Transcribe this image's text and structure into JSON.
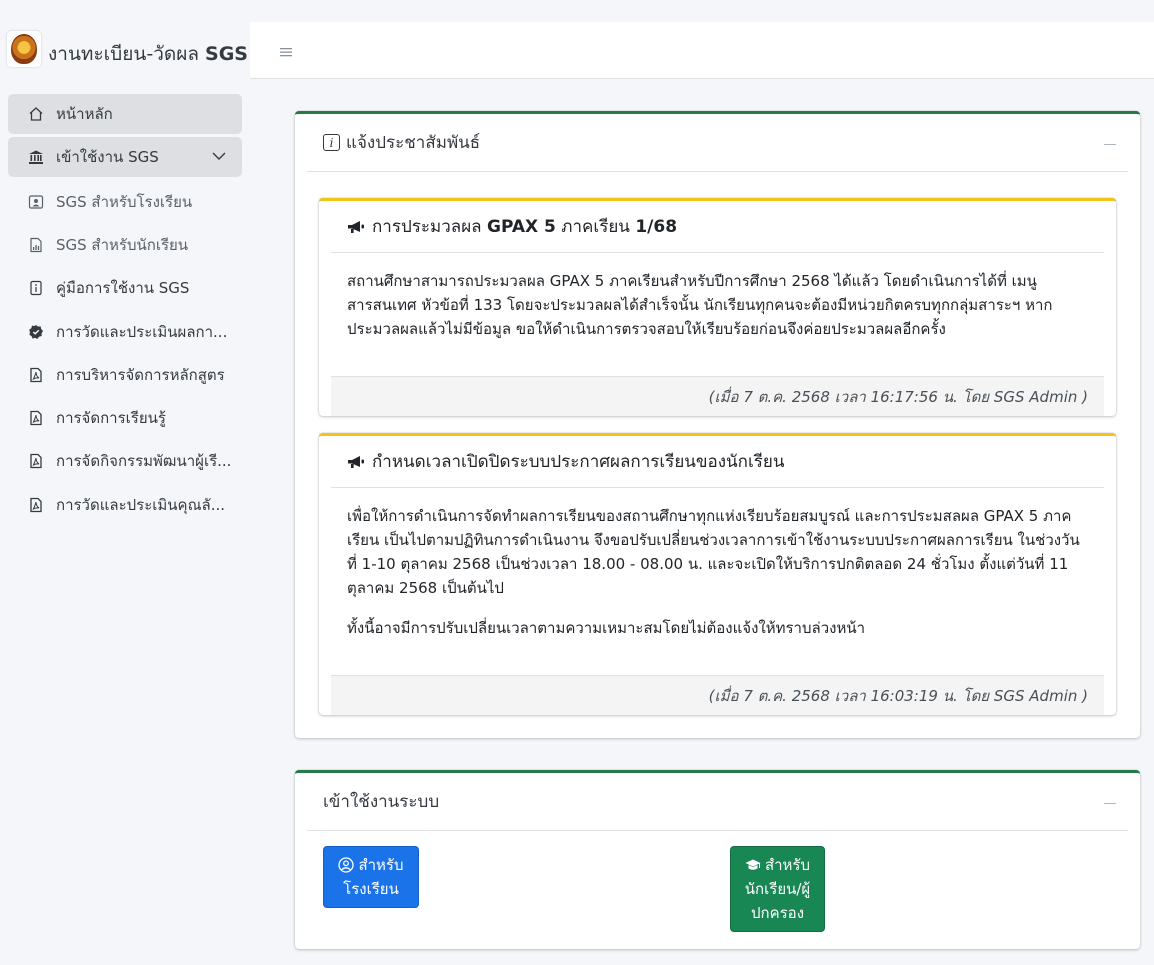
{
  "brand": {
    "prefix": "งานทะเบียน-วัดผล",
    "name": "SGS"
  },
  "sidebar": {
    "items": [
      {
        "label": "หน้าหลัก",
        "icon": "home-icon"
      },
      {
        "label": "เข้าใช้งาน SGS",
        "icon": "bank-icon"
      }
    ],
    "sub_items": [
      {
        "label": "SGS สำหรับโรงเรียน",
        "icon": "person-badge-icon"
      },
      {
        "label": "SGS สำหรับนักเรียน",
        "icon": "file-chart-icon"
      },
      {
        "label": "คู่มือการใช้งาน SGS",
        "icon": "file-info-icon"
      },
      {
        "label": "การวัดและประเมินผลกา...",
        "icon": "patch-check-icon"
      },
      {
        "label": "การบริหารจัดการหลักสูตร",
        "icon": "file-pdf-icon"
      },
      {
        "label": "การจัดการเรียนรู้",
        "icon": "file-pdf-icon"
      },
      {
        "label": "การจัดกิจกรรมพัฒนาผู้เรี...",
        "icon": "file-pdf-icon"
      },
      {
        "label": "การวัดและประเมินคุณลั...",
        "icon": "file-pdf-icon"
      }
    ]
  },
  "announcements": {
    "title": "แจ้งประชาสัมพันธ์",
    "posts": [
      {
        "title_prefix": "การประมวลผล",
        "title_bold": "GPAX 5",
        "title_mid": "ภาคเรียน",
        "title_bold2": "1/68",
        "body": [
          "สถานศึกษาสามารถประมวลผล GPAX 5 ภาคเรียนสำหรับปีการศึกษา 2568 ได้แล้ว โดยดำเนินการได้ที่ เมนู สารสนเทศ หัวข้อที่ 133 โดยจะประมวลผลได้สำเร็จนั้น นักเรียนทุกคนจะต้องมีหน่วยกิตครบทุกกลุ่มสาระฯ หากประมวลผลแล้วไม่มีข้อมูล ขอให้ดำเนินการตรวจสอบให้เรียบร้อยก่อนจึงค่อยประมวลผลอีกครั้ง"
        ],
        "footer": "(เมื่อ 7 ต.ค. 2568 เวลา 16:17:56 น. โดย SGS Admin )"
      },
      {
        "title_prefix": "กำหนดเวลาเปิดปิดระบบประกาศผลการเรียนของนักเรียน",
        "title_bold": "",
        "title_mid": "",
        "title_bold2": "",
        "body": [
          "เพื่อให้การดำเนินการจัดทำผลการเรียนของสถานศึกษาทุกแห่งเรียบร้อยสมบูรณ์ และการประมสลผล GPAX 5 ภาคเรียน เป็นไปตามปฏิทินการดำเนินงาน จึงขอปรับเปลี่ยนช่วงเวลาการเข้าใช้งานระบบประกาศผลการเรียน ในช่วงวันที่ 1-10 ตุลาคม 2568 เป็นช่วงเวลา 18.00 - 08.00 น. และจะเปิดให้บริการปกติตลอด 24 ชั่วโมง ตั้งแต่วันที่ 11 ตุลาคม 2568 เป็นต้นไป",
          "ทั้งนี้อาจมีการปรับเปลี่ยนเวลาตามความเหมาะสมโดยไม่ต้องแจ้งให้ทราบล่วงหน้า"
        ],
        "footer": "(เมื่อ 7 ต.ค. 2568 เวลา 16:03:19 น. โดย SGS Admin )"
      }
    ]
  },
  "login": {
    "title": "เข้าใช้งานระบบ",
    "school_button": {
      "line1": "สำหรับ",
      "line2": "โรงเรียน",
      "icon": "person-circle-icon"
    },
    "student_button": {
      "line1": "สำหรับ",
      "line2": "นักเรียน/ผู้",
      "line3": "ปกครอง",
      "icon": "graduation-cap-icon"
    }
  },
  "colors": {
    "card_accent": "#28794a",
    "news_accent": "#f0c419",
    "school_button": "#1a73e8",
    "student_button": "#198754"
  }
}
